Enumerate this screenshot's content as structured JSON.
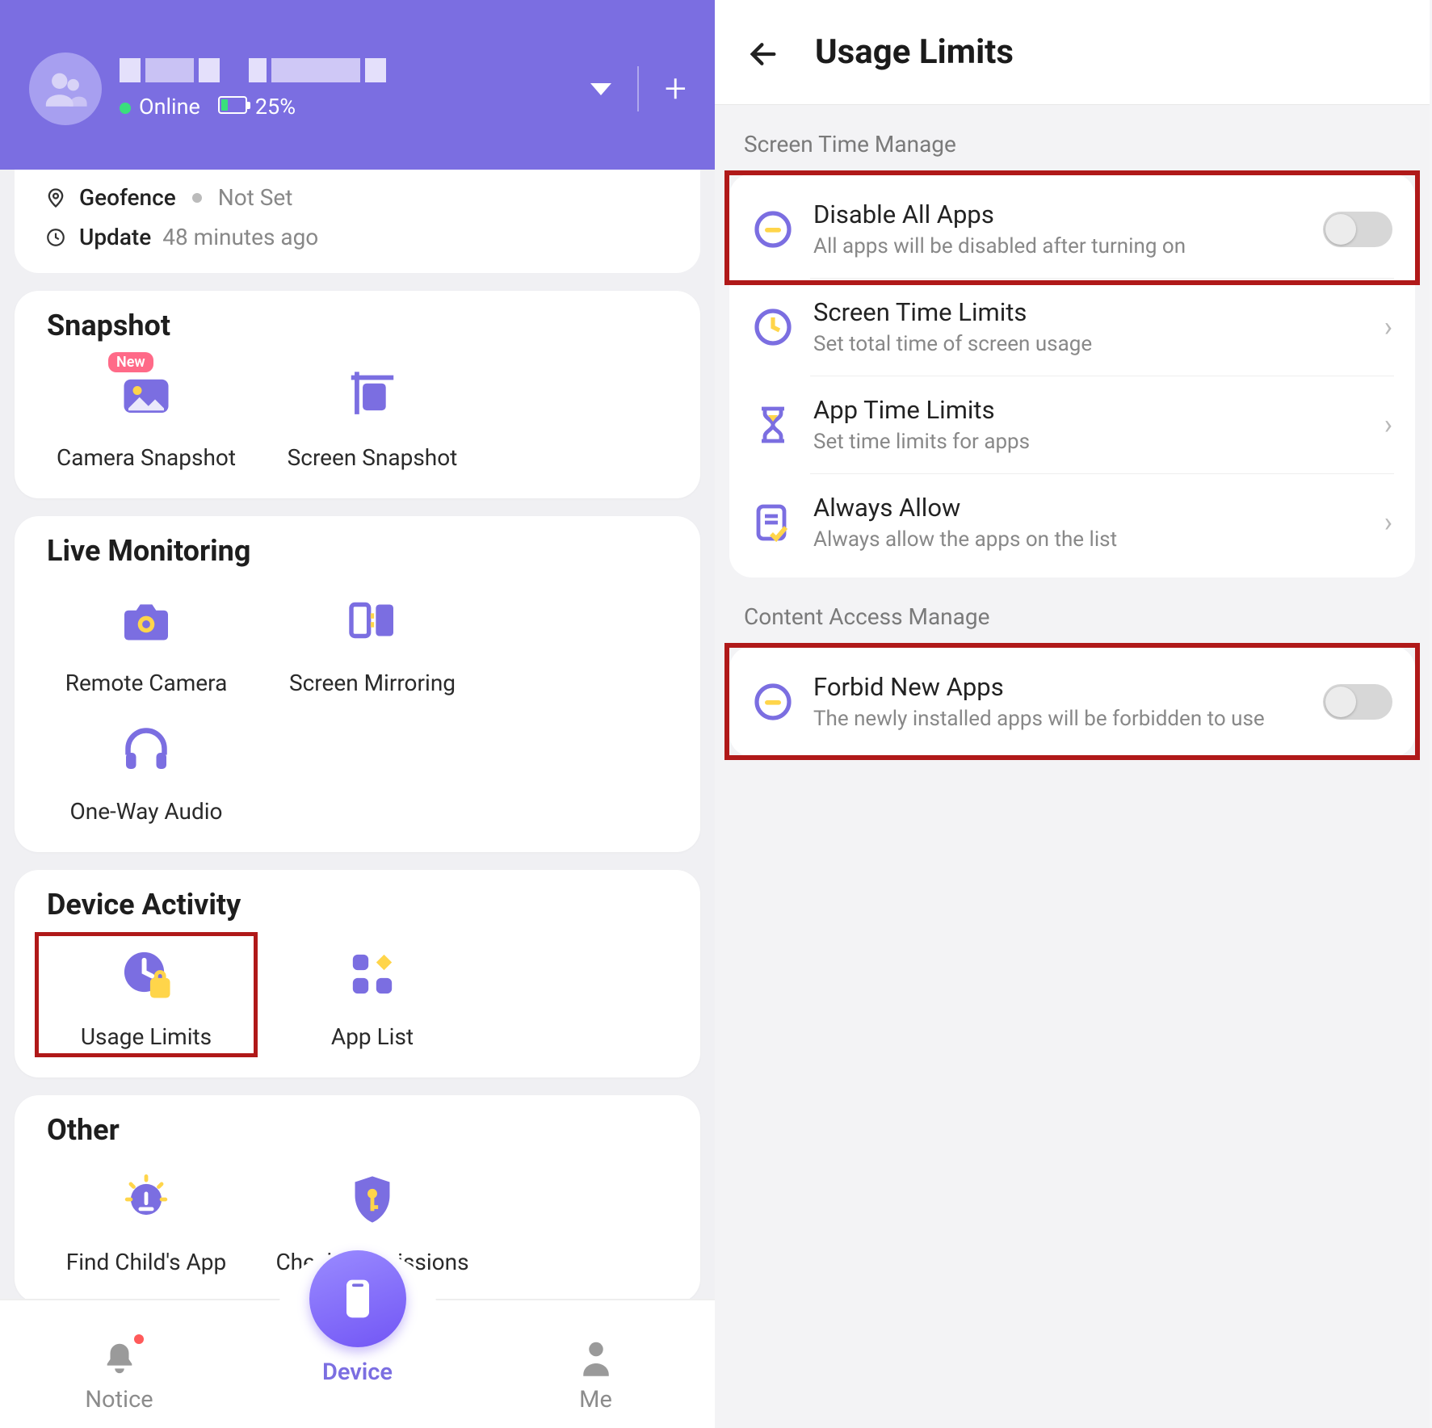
{
  "left": {
    "header": {
      "status_online": "Online",
      "battery_pct": "25%"
    },
    "info": {
      "geofence_label": "Geofence",
      "geofence_value": "Not Set",
      "update_label": "Update",
      "update_value": "48 minutes ago"
    },
    "snapshot": {
      "title": "Snapshot",
      "badge_new": "New",
      "items": [
        "Camera Snapshot",
        "Screen Snapshot"
      ]
    },
    "live": {
      "title": "Live Monitoring",
      "items": [
        "Remote Camera",
        "Screen Mirroring",
        "One-Way Audio"
      ]
    },
    "activity": {
      "title": "Device Activity",
      "items": [
        "Usage Limits",
        "App List"
      ]
    },
    "other": {
      "title": "Other",
      "items": [
        "Find Child's App",
        "Check Permissions"
      ]
    },
    "nav": {
      "notice": "Notice",
      "device": "Device",
      "me": "Me"
    }
  },
  "right": {
    "title": "Usage Limits",
    "group1_label": "Screen Time Manage",
    "disable_all": {
      "title": "Disable All Apps",
      "sub": "All apps will be disabled after turning on"
    },
    "screen_time": {
      "title": "Screen Time Limits",
      "sub": "Set total time of screen usage"
    },
    "app_time": {
      "title": "App Time Limits",
      "sub": "Set time limits for apps"
    },
    "always": {
      "title": "Always Allow",
      "sub": "Always allow the apps on the list"
    },
    "group2_label": "Content Access Manage",
    "forbid": {
      "title": "Forbid New Apps",
      "sub": "The newly installed apps will be forbidden to use"
    }
  }
}
